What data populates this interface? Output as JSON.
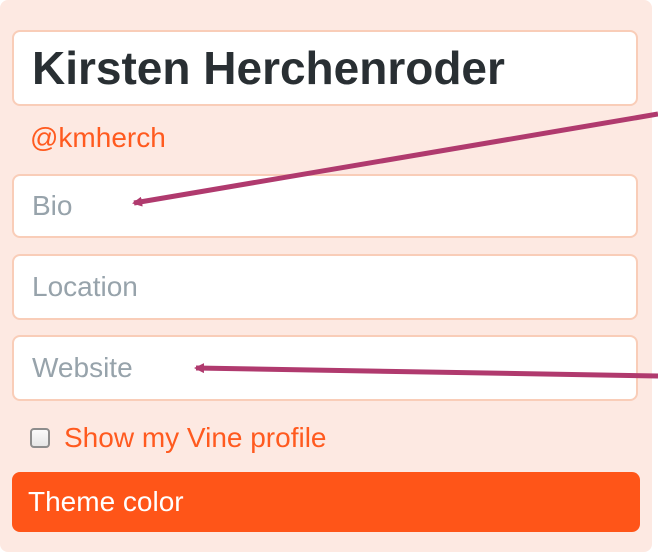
{
  "profile": {
    "name_value": "Kirsten Herchenroder",
    "handle": "@kmherch",
    "bio_placeholder": "Bio",
    "location_placeholder": "Location",
    "website_placeholder": "Website",
    "show_vine_label": "Show my Vine profile",
    "show_vine_checked": false,
    "theme_color_label": "Theme color"
  },
  "colors": {
    "accent": "#ff5518",
    "panel_background": "#fde9e2",
    "field_border": "#f9cdb8",
    "annotation_arrow": "#b03a6e"
  }
}
